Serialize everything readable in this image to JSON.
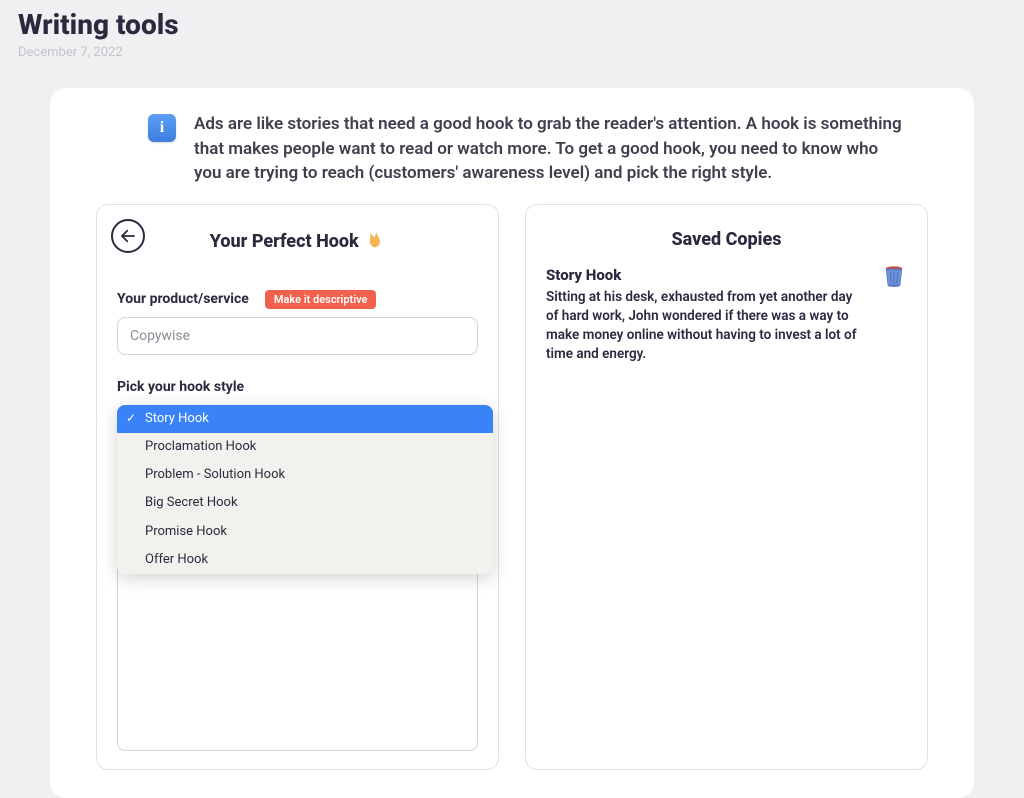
{
  "page": {
    "title": "Writing tools",
    "date": "December 7, 2022"
  },
  "info": {
    "text": "Ads are like stories that need a good hook to grab the reader's attention. A hook is something that makes people want to read or watch more. To get a good hook, you need to know who you are trying to reach (customers' awareness level) and pick the right style."
  },
  "form": {
    "title": "Your Perfect Hook",
    "product_label": "Your product/service",
    "badge": "Make it descriptive",
    "product_value": "Copywise",
    "hook_style_label": "Pick your hook style",
    "hook_options": [
      "Story Hook",
      "Proclamation Hook",
      "Problem - Solution Hook",
      "Big Secret Hook",
      "Promise Hook",
      "Offer Hook"
    ],
    "hook_selected": "Story Hook"
  },
  "saved": {
    "title": "Saved Copies",
    "items": [
      {
        "heading": "Story Hook",
        "body": "Sitting at his desk, exhausted from yet another day of hard work, John wondered if there was a way to make money online without having to invest a lot of time and energy."
      }
    ]
  }
}
